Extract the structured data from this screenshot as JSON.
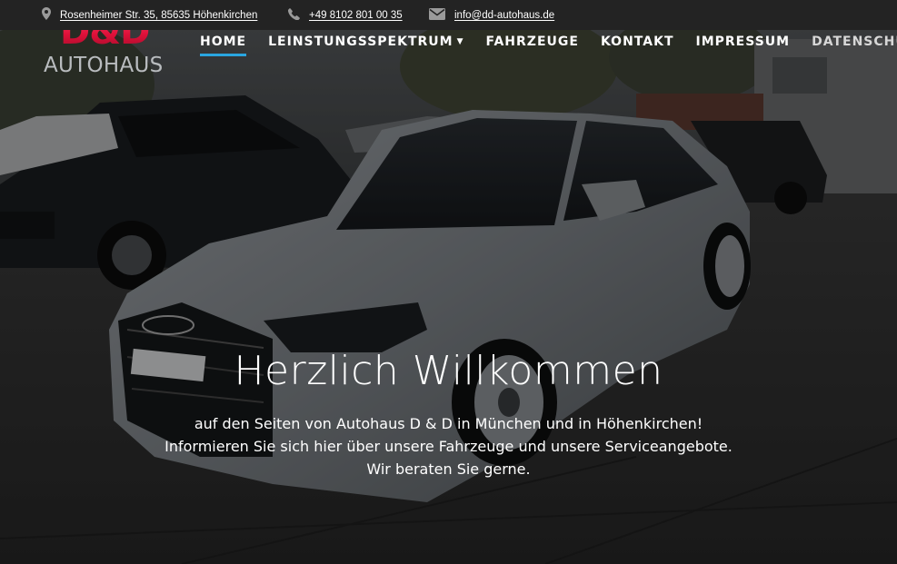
{
  "topbar": {
    "address": "Rosenheimer Str. 35, 85635 Höhenkirchen",
    "phone": "+49 8102 801 00 35",
    "email": "info@dd-autohaus.de"
  },
  "logo": {
    "mark": "D&D",
    "name": "AUTOHAUS"
  },
  "nav": {
    "items": [
      {
        "label": "HOME",
        "active": true
      },
      {
        "label": "LEINSTUNGSSPEKTRUM",
        "dropdown": true
      },
      {
        "label": "FAHRZEUGE"
      },
      {
        "label": "KONTAKT"
      },
      {
        "label": "IMPRESSUM"
      },
      {
        "label": "DATENSCHUTZ"
      }
    ]
  },
  "hero": {
    "headline": "Herzlich Willkommen",
    "lines": [
      "auf den Seiten von Autohaus D & D in München und in Höhenkirchen!",
      "Informieren Sie sich hier über unsere Fahrzeuge und unsere Serviceangebote.",
      "Wir beraten Sie gerne."
    ]
  },
  "colors": {
    "brand_red": "#e0113a",
    "nav_active_underline": "#2aa6e0",
    "topbar_bg": "#232323"
  },
  "icons": [
    "map-marker-icon",
    "phone-icon",
    "envelope-icon",
    "caret-down-icon"
  ]
}
